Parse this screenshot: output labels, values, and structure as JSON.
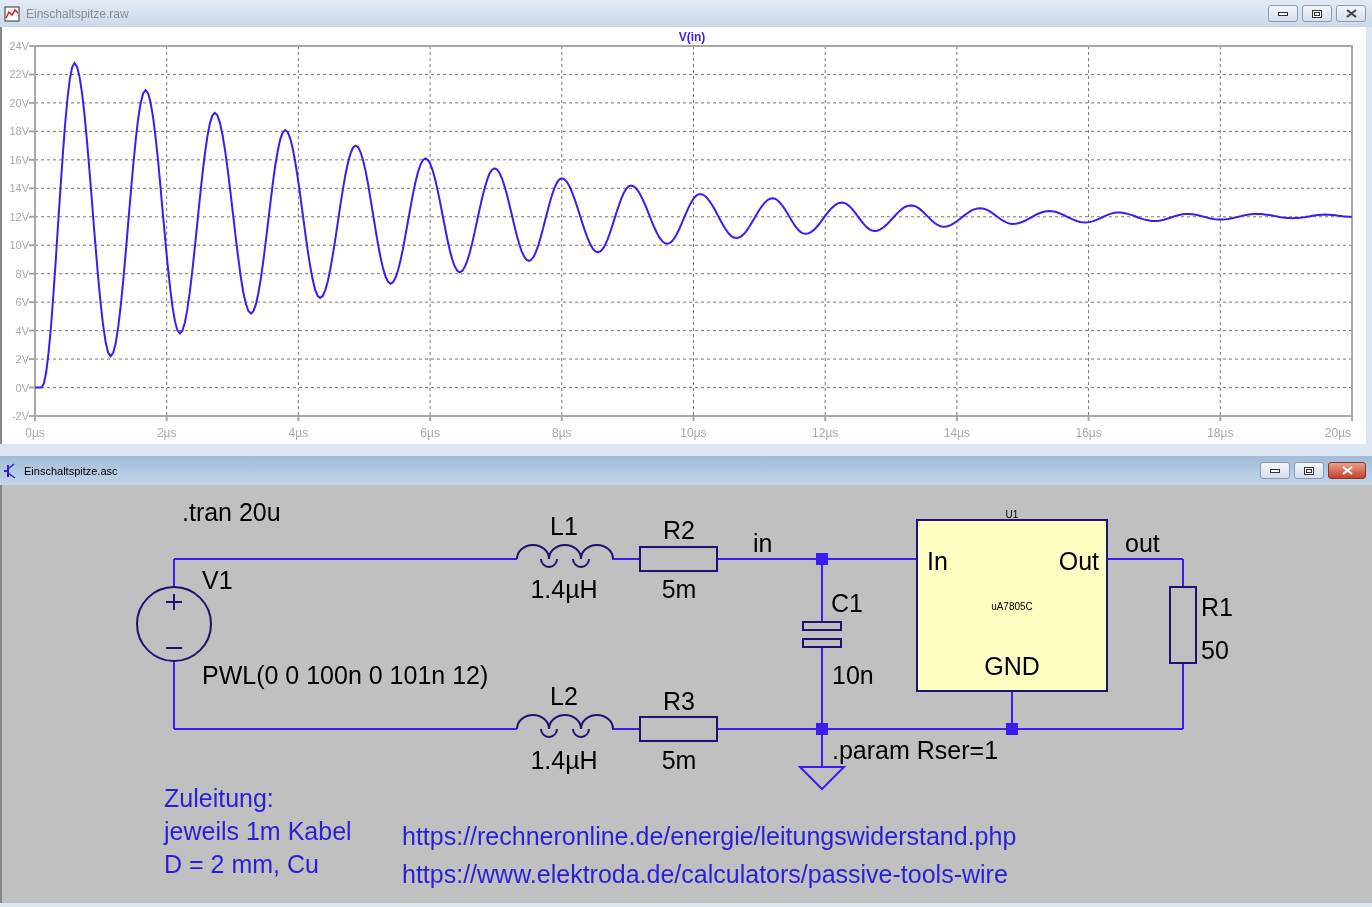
{
  "windows": [
    {
      "title": "Einschaltspitze.raw",
      "active": false,
      "chart_data": {
        "type": "line",
        "grid": true,
        "x": [
          0,
          0.1,
          0.6,
          1.15,
          1.68,
          2.2,
          2.73,
          3.28,
          3.8,
          4.33,
          4.87,
          5.4,
          5.93,
          6.45,
          6.98,
          7.5,
          8.0,
          8.55,
          9.05,
          9.6,
          10.1,
          10.65,
          11.2,
          11.7,
          12.25,
          12.75,
          13.3,
          13.8,
          14.35,
          14.85,
          15.4,
          15.95,
          16.45,
          17.0,
          17.5,
          18.0,
          18.55,
          19.1,
          19.6,
          20
        ],
        "series": [
          {
            "name": "V(in)",
            "color": "#3a1df2",
            "values": [
              0,
              0,
              22.8,
              2.2,
              20.9,
              3.8,
              19.3,
              5.2,
              18.1,
              6.3,
              17.0,
              7.3,
              16.1,
              8.1,
              15.4,
              8.9,
              14.7,
              9.5,
              14.2,
              10.1,
              13.6,
              10.5,
              13.3,
              10.8,
              13.0,
              11.0,
              12.8,
              11.3,
              12.6,
              11.5,
              12.4,
              11.6,
              12.3,
              11.7,
              12.2,
              11.8,
              12.2,
              11.9,
              12.15,
              12.0
            ]
          }
        ],
        "xlim": [
          0,
          20
        ],
        "ylim": [
          -2,
          24
        ],
        "xticks": [
          {
            "value": 0,
            "label": "0µs"
          },
          {
            "value": 2,
            "label": "2µs"
          },
          {
            "value": 4,
            "label": "4µs"
          },
          {
            "value": 6,
            "label": "6µs"
          },
          {
            "value": 8,
            "label": "8µs"
          },
          {
            "value": 10,
            "label": "10µs"
          },
          {
            "value": 12,
            "label": "12µs"
          },
          {
            "value": 14,
            "label": "14µs"
          },
          {
            "value": 16,
            "label": "16µs"
          },
          {
            "value": 18,
            "label": "18µs"
          },
          {
            "value": 20,
            "label": "20µs"
          }
        ],
        "yticks": [
          {
            "value": 24,
            "label": "24V"
          },
          {
            "value": 22,
            "label": "22V"
          },
          {
            "value": 20,
            "label": "20V"
          },
          {
            "value": 18,
            "label": "18V"
          },
          {
            "value": 16,
            "label": "16V"
          },
          {
            "value": 14,
            "label": "14V"
          },
          {
            "value": 12,
            "label": "12V"
          },
          {
            "value": 10,
            "label": "10V"
          },
          {
            "value": 8,
            "label": "8V"
          },
          {
            "value": 6,
            "label": "6V"
          },
          {
            "value": 4,
            "label": "4V"
          },
          {
            "value": 2,
            "label": "2V"
          },
          {
            "value": 0,
            "label": "0V"
          },
          {
            "value": -2,
            "label": "-2V"
          }
        ]
      }
    },
    {
      "title": "Einschaltspitze.asc",
      "active": true,
      "schematic": {
        "directives": [
          ".tran 20u",
          ".param Rser=1"
        ],
        "components": [
          {
            "kind": "voltage_source",
            "ref": "V1",
            "value": "PWL(0 0 100n 0 101n 12)"
          },
          {
            "kind": "inductor",
            "ref": "L1",
            "value": "1.4µH"
          },
          {
            "kind": "resistor",
            "ref": "R2",
            "value": "5m"
          },
          {
            "kind": "inductor",
            "ref": "L2",
            "value": "1.4µH"
          },
          {
            "kind": "resistor",
            "ref": "R3",
            "value": "5m"
          },
          {
            "kind": "capacitor",
            "ref": "C1",
            "value": "10n"
          },
          {
            "kind": "regulator",
            "ref": "U1",
            "value": "uA7805C",
            "pins": [
              "In",
              "Out",
              "GND"
            ]
          },
          {
            "kind": "resistor",
            "ref": "R1",
            "value": "50"
          }
        ],
        "net_labels": [
          "in",
          "out"
        ],
        "comment": [
          "Zuleitung:",
          "jeweils 1m Kabel",
          "D = 2 mm, Cu"
        ],
        "links": [
          "https://rechneronline.de/energie/leitungswiderstand.php",
          "https://www.elektroda.de/calculators/passive-tools-wire"
        ]
      }
    }
  ]
}
